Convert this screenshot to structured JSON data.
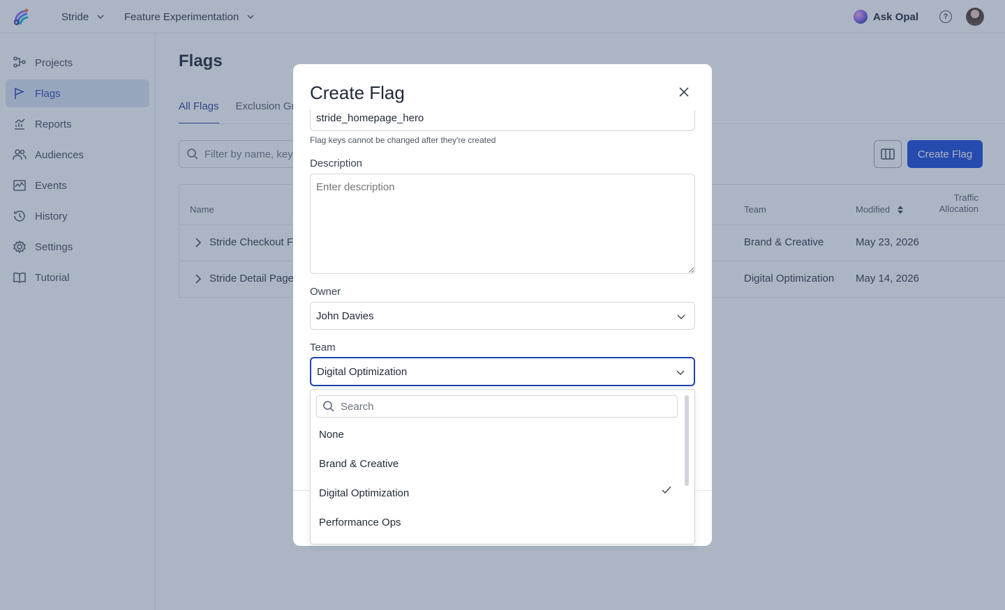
{
  "topbar": {
    "project_switcher": "Stride",
    "product_switcher": "Feature Experimentation",
    "ask_opal": "Ask Opal",
    "help_glyph": "?"
  },
  "sidebar": {
    "items": [
      {
        "label": "Projects",
        "icon": "projects-icon"
      },
      {
        "label": "Flags",
        "icon": "flag-icon",
        "active": true
      },
      {
        "label": "Reports",
        "icon": "reports-icon"
      },
      {
        "label": "Audiences",
        "icon": "audiences-icon"
      },
      {
        "label": "Events",
        "icon": "events-icon"
      },
      {
        "label": "History",
        "icon": "history-icon"
      },
      {
        "label": "Settings",
        "icon": "gear-icon"
      },
      {
        "label": "Tutorial",
        "icon": "book-icon"
      }
    ]
  },
  "main": {
    "title": "Flags",
    "tabs": [
      {
        "label": "All Flags",
        "active": true
      },
      {
        "label": "Exclusion Gr"
      }
    ],
    "filter_placeholder": "Filter by name, key,",
    "create_button": "Create Flag",
    "table": {
      "headers": {
        "name": "Name",
        "team": "Team",
        "modified": "Modified",
        "traffic_line1": "Traffic",
        "traffic_line2": "Allocation"
      },
      "rows": [
        {
          "name": "Stride Checkout Fl",
          "team": "Brand & Creative",
          "modified": "May 23, 2026"
        },
        {
          "name": "Stride Detail Page",
          "team": "Digital Optimization",
          "modified": "May 14, 2026"
        }
      ]
    }
  },
  "modal": {
    "title": "Create Flag",
    "flag_key_value": "stride_homepage_hero",
    "flag_key_hint": "Flag keys cannot be changed after they're created",
    "description_label": "Description",
    "description_placeholder": "Enter description",
    "owner_label": "Owner",
    "owner_value": "John Davies",
    "team_label": "Team",
    "team_value": "Digital Optimization"
  },
  "team_dropdown": {
    "search_placeholder": "Search",
    "options": [
      {
        "label": "None"
      },
      {
        "label": "Brand & Creative"
      },
      {
        "label": "Digital Optimization",
        "selected": true
      },
      {
        "label": "Performance Ops"
      }
    ]
  },
  "colors": {
    "primary": "#0b3fd9",
    "active_nav_bg": "#dbe4f3",
    "overlay": "#465a7d"
  }
}
